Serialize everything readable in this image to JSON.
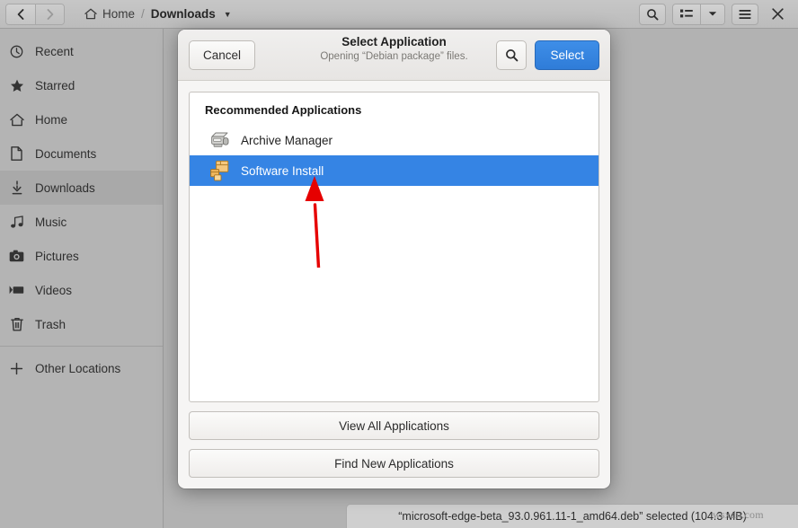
{
  "window": {
    "nav": {
      "back_icon": "chevron-left-icon",
      "forward_icon": "chevron-right-icon"
    },
    "breadcrumb": {
      "home_icon": "home-icon",
      "home_label": "Home",
      "separator": "/",
      "current_label": "Downloads",
      "caret": "▼"
    },
    "actions": {
      "search_icon": "search-icon",
      "view_icon": "list-view-icon",
      "view_caret": "▼",
      "menu_icon": "hamburger-menu-icon",
      "close_icon": "close-icon"
    }
  },
  "sidebar": {
    "items": [
      {
        "label": "Recent",
        "icon": "clock-icon",
        "selected": false
      },
      {
        "label": "Starred",
        "icon": "star-icon",
        "selected": false
      },
      {
        "label": "Home",
        "icon": "home-icon",
        "selected": false
      },
      {
        "label": "Documents",
        "icon": "document-icon",
        "selected": false
      },
      {
        "label": "Downloads",
        "icon": "download-icon",
        "selected": true
      },
      {
        "label": "Music",
        "icon": "music-icon",
        "selected": false
      },
      {
        "label": "Pictures",
        "icon": "camera-icon",
        "selected": false
      },
      {
        "label": "Videos",
        "icon": "video-icon",
        "selected": false
      },
      {
        "label": "Trash",
        "icon": "trash-icon",
        "selected": false
      }
    ],
    "other_locations": {
      "label": "Other Locations",
      "icon": "plus-icon"
    }
  },
  "dialog": {
    "cancel_label": "Cancel",
    "title": "Select Application",
    "subtitle": "Opening “Debian package” files.",
    "search_icon": "search-icon",
    "select_label": "Select",
    "group_header": "Recommended Applications",
    "apps": [
      {
        "name": "Archive Manager",
        "icon": "archive-manager-icon",
        "selected": false
      },
      {
        "name": "Software Install",
        "icon": "software-install-icon",
        "selected": true
      }
    ],
    "view_all_label": "View All Applications",
    "find_new_label": "Find New Applications"
  },
  "statusbar": {
    "text": "“microsoft-edge-beta_93.0.961.11-1_amd64.deb” selected (104.3 MB)"
  },
  "watermark": {
    "text": "wsxdn.com"
  },
  "annotation": {
    "arrow_color": "#e60000",
    "name": "red-pointer-arrow"
  },
  "colors": {
    "accent_blue": "#3584e4",
    "select_button": "#3584e4",
    "backdrop": "#b2b2b2",
    "sidebar": "#b4b4b4",
    "dialog_bg": "#f6f5f4",
    "list_bg": "#ffffff"
  }
}
